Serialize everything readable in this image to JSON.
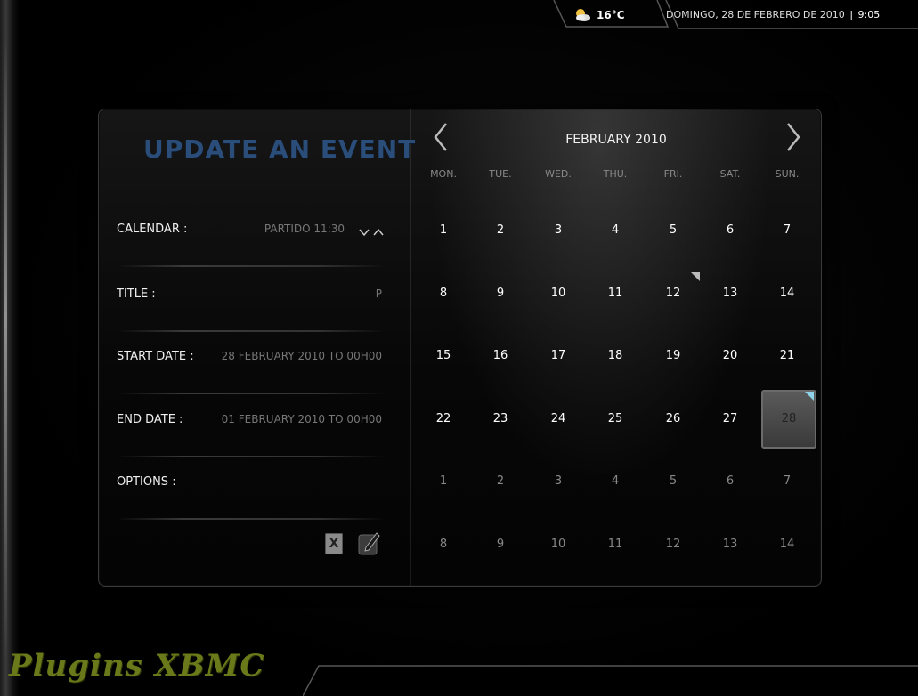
{
  "status": {
    "temperature": "16°C",
    "date": "DOMINGO, 28 DE FEBRERO DE 2010",
    "separator": "|",
    "time": "9:05"
  },
  "form": {
    "title": "UPDATE AN EVENT",
    "fields": [
      {
        "label": "CALENDAR :",
        "value": "PARTIDO 11:30"
      },
      {
        "label": "TITLE :",
        "value": "P"
      },
      {
        "label": "START DATE :",
        "value": "28 FEBRUARY 2010 TO 00H00"
      },
      {
        "label": "END DATE :",
        "value": "01 FEBRUARY 2010 TO 00H00"
      },
      {
        "label": "OPTIONS :",
        "value": ""
      }
    ],
    "cancel_label": "X"
  },
  "calendar": {
    "month_title": "FEBRUARY 2010",
    "weekdays": [
      "MON.",
      "TUE.",
      "WED.",
      "THU.",
      "FRI.",
      "SAT.",
      "SUN."
    ],
    "weeks": [
      [
        "1",
        "2",
        "3",
        "4",
        "5",
        "6",
        "7"
      ],
      [
        "8",
        "9",
        "10",
        "11",
        "12",
        "13",
        "14"
      ],
      [
        "15",
        "16",
        "17",
        "18",
        "19",
        "20",
        "21"
      ],
      [
        "22",
        "23",
        "24",
        "25",
        "26",
        "27",
        "28"
      ],
      [
        "1",
        "2",
        "3",
        "4",
        "5",
        "6",
        "7"
      ],
      [
        "8",
        "9",
        "10",
        "11",
        "12",
        "13",
        "14"
      ]
    ],
    "muted_weeks": [
      4,
      5
    ],
    "selected_day": "28",
    "event_days": [
      "12",
      "28"
    ]
  },
  "watermark": "Plugins XBMC",
  "icons": {
    "weather": "partly-cloudy-icon",
    "prev": "chevron-left-icon",
    "next": "chevron-right-icon",
    "edit": "edit-pencil-icon"
  }
}
